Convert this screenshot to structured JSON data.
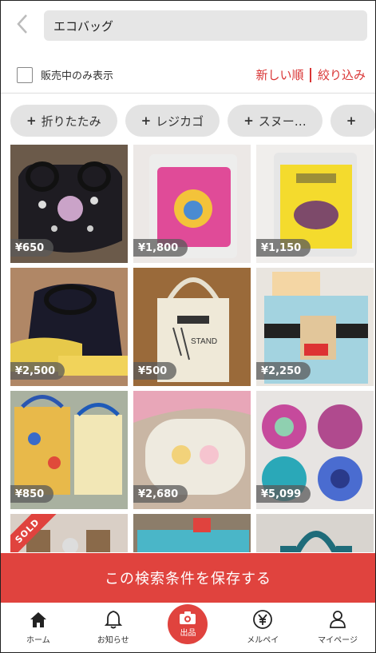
{
  "header": {
    "back_icon": "chevron-left-icon",
    "search_value": "エコバッグ"
  },
  "filter": {
    "on_sale_only_label": "販売中のみ表示",
    "on_sale_only_checked": false,
    "sort_label": "新しい順",
    "refine_label": "絞り込み"
  },
  "chips": [
    {
      "label": "折りたたみ"
    },
    {
      "label": "レジカゴ"
    },
    {
      "label": "スヌー…"
    },
    {
      "label": ""
    }
  ],
  "items": [
    {
      "price": "¥650"
    },
    {
      "price": "¥1,800"
    },
    {
      "price": "¥1,150"
    },
    {
      "price": "¥2,500"
    },
    {
      "price": "¥500"
    },
    {
      "price": "¥2,250"
    },
    {
      "price": "¥850"
    },
    {
      "price": "¥2,680"
    },
    {
      "price": "¥5,099"
    },
    {
      "price": "",
      "sold_label": "SOLD"
    },
    {
      "price": ""
    },
    {
      "price": ""
    }
  ],
  "save_bar": {
    "label": "この検索条件を保存する"
  },
  "bottom_nav": {
    "home": "ホーム",
    "notifications": "お知らせ",
    "sell": "出品",
    "merpay": "メルペイ",
    "mypage": "マイページ"
  },
  "colors": {
    "accent": "#e0433e"
  }
}
